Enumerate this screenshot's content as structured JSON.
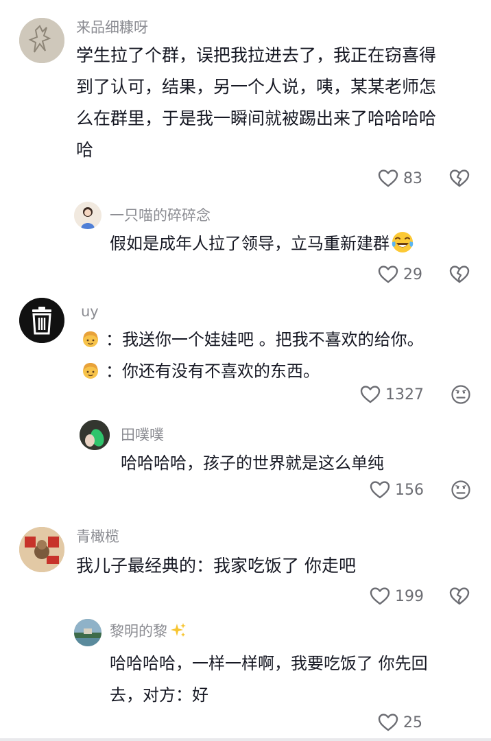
{
  "comments": [
    {
      "user": "来品细糠呀",
      "lines": [
        "学生拉了个群，误把我拉进去了，我正在窃喜得",
        "到了认可，结果，另一个人说，咦，某某老师怎",
        "么在群里，于是我一瞬间就被踢出来了哈哈哈哈",
        "哈"
      ],
      "likes": "83",
      "reply": {
        "user": "一只喵的碎碎念",
        "lines": [
          "假如是成年人拉了领导，立马重新建群"
        ],
        "likes": "29"
      }
    },
    {
      "user": "uy",
      "lines": [
        "：我送你一个娃娃吧 。把我不喜欢的给你。",
        "：你还有没有不喜欢的东西。"
      ],
      "likes": "1327",
      "reply": {
        "user": "田噗噗",
        "lines": [
          "哈哈哈哈，孩子的世界就是这么单纯"
        ],
        "likes": "156"
      }
    },
    {
      "user": "青橄榄",
      "lines": [
        "我儿子最经典的：我家吃饭了 你走吧"
      ],
      "likes": "199",
      "reply": {
        "user": "黎明的黎",
        "lines": [
          "哈哈哈哈，一样一样啊，我要吃饭了 你先回",
          "去，对方：好"
        ],
        "likes": "25"
      }
    }
  ],
  "icons": {
    "like": "heart-outline-icon",
    "dislike": "broken-heart-icon",
    "neutral": "neutral-face-icon",
    "laugh_emoji": "tears-of-joy-emoji",
    "child_emoji": "girl-face-emoji",
    "sparkle": "sparkles-emoji",
    "trash_avatar": "trash-can-icon"
  },
  "colors": {
    "name": "#8a8b91",
    "text": "#161823",
    "count": "#6b6c72"
  }
}
